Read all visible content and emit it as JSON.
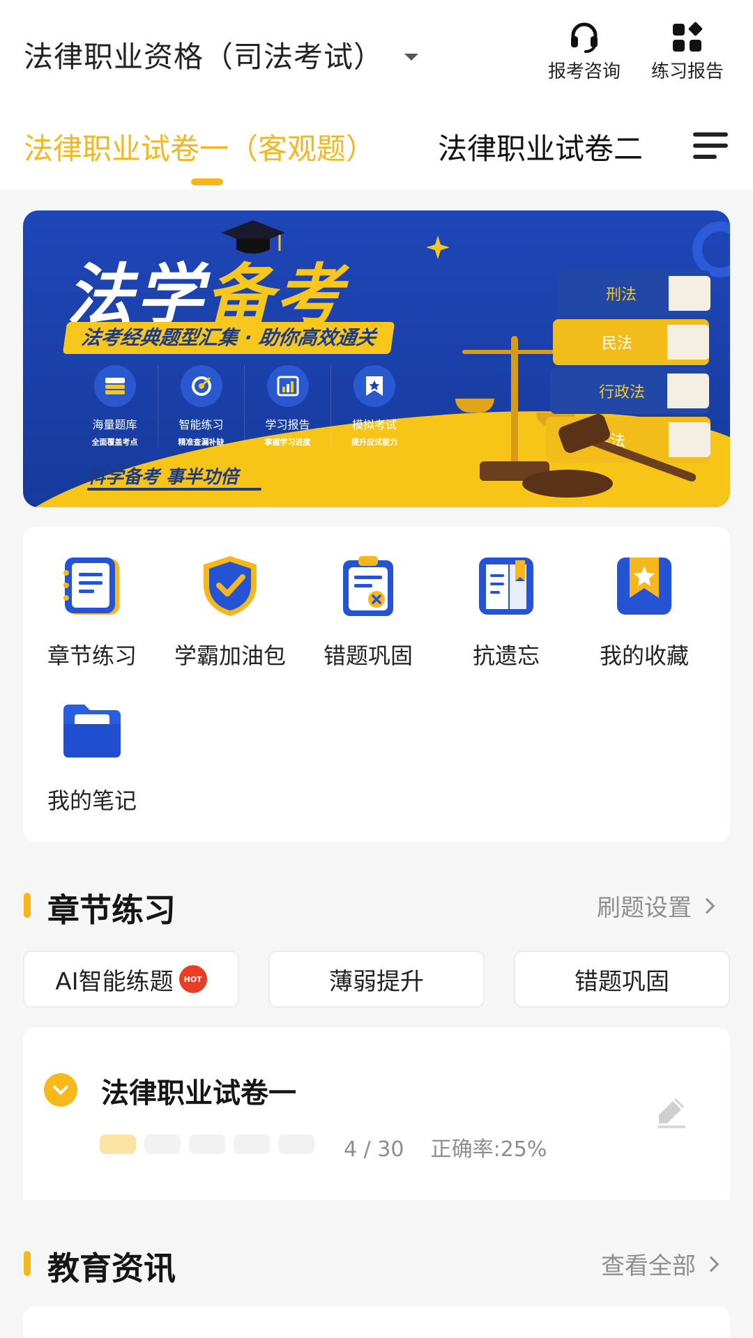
{
  "header": {
    "exam_title": "法律职业资格（司法考试）",
    "consult_label": "报考咨询",
    "report_label": "练习报告"
  },
  "tabs": [
    {
      "label": "法律职业试卷一（客观题）",
      "active": true
    },
    {
      "label": "法律职业试卷二",
      "active": false
    }
  ],
  "banner": {
    "title_part1": "法学",
    "title_part2": "备考",
    "slogan": "法考经典题型汇集 · 助你高效通关",
    "features": [
      {
        "title": "海量题库",
        "subtitle": "全面覆盖考点",
        "icon": "stack-icon"
      },
      {
        "title": "智能练习",
        "subtitle": "精准查漏补缺",
        "icon": "target-icon"
      },
      {
        "title": "学习报告",
        "subtitle": "掌握学习进度",
        "icon": "chart-icon"
      },
      {
        "title": "模拟考试",
        "subtitle": "提升应试能力",
        "icon": "bookmark-icon"
      }
    ],
    "motto": "科学备考  事半功倍",
    "books": [
      "刑法",
      "民法",
      "行政法",
      "宪法"
    ]
  },
  "features": [
    {
      "label": "章节练习",
      "icon": "notebook-icon"
    },
    {
      "label": "学霸加油包",
      "icon": "shield-check-icon"
    },
    {
      "label": "错题巩固",
      "icon": "clipboard-x-icon"
    },
    {
      "label": "抗遗忘",
      "icon": "book-note-icon"
    },
    {
      "label": "我的收藏",
      "icon": "star-bookmark-icon"
    },
    {
      "label": "我的笔记",
      "icon": "folder-icon"
    }
  ],
  "chapter_section": {
    "title": "章节练习",
    "settings_link": "刷题设置",
    "buttons": [
      {
        "label": "AI智能练题",
        "badge": "HOT"
      },
      {
        "label": "薄弱提升"
      },
      {
        "label": "错题巩固"
      }
    ],
    "chapter": {
      "name": "法律职业试卷一",
      "progress_text": "4 / 30",
      "accuracy_text": "正确率:25%",
      "progress": 0.13
    }
  },
  "news_section": {
    "title": "教育资讯",
    "link": "查看全部"
  },
  "colors": {
    "accent": "#f5b71c",
    "brand_blue": "#1f46b8",
    "text": "#1e1e1e",
    "muted": "#8f8f8f"
  }
}
